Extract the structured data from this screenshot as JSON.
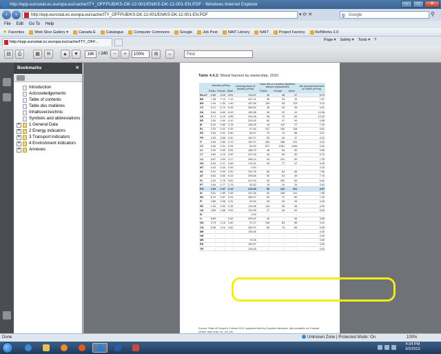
{
  "window": {
    "title": "http://epp.eurostat.ec.europa.eu/cache/ITY_OFFPUB/KS-DK-12-001/EN/KS-DK-12-001-EN.PDF - Windows Internet Explorer",
    "min": "–",
    "max": "□",
    "close": "✕"
  },
  "address": {
    "url": "http://epp.eurostat.ec.europa.eu/cache/ITY_OFFPUB/KS-DK-12-001/EN/KS-DK-12-001-EN.PDF",
    "tools": "▾ ⟳ ✕",
    "search_placeholder": "Google",
    "search_btn": "⚲"
  },
  "menu": [
    "File",
    "Edit",
    "Go To",
    "Help"
  ],
  "favorites": {
    "label": "Favorites",
    "items": [
      "Web Slice Gallery ▾",
      "Canada E",
      "Catalogue",
      "Computer Commons",
      "Google",
      "Job Post",
      "NAIT Library",
      "NAIT",
      "Project Factory",
      "RefWorks 2.0"
    ]
  },
  "tab": {
    "label": "http://epp.eurostat.ec.europa.eu/cache/ITY_OFF..."
  },
  "commands": [
    "Page ▾",
    "Safety ▾",
    "Tools ▾",
    "?"
  ],
  "pdf_toolbar": {
    "page": "186",
    "total": "/ 240",
    "zoom": "100%",
    "find_placeholder": "Find"
  },
  "bookmarks": {
    "title": "Bookmarks",
    "close": "✕",
    "items": [
      {
        "label": "Introduction",
        "expandable": false
      },
      {
        "label": "Acknowledgements",
        "expandable": false
      },
      {
        "label": "Table of contents",
        "expandable": false
      },
      {
        "label": "Table des matières",
        "expandable": false
      },
      {
        "label": "Inhaltsverzeichnis",
        "expandable": false
      },
      {
        "label": "Symbols and abbreviations",
        "expandable": false
      },
      {
        "label": "1 General Data",
        "expandable": true
      },
      {
        "label": "2 Energy indicators",
        "expandable": true
      },
      {
        "label": "3 Transport indicators",
        "expandable": true
      },
      {
        "label": "4 Environment indicators",
        "expandable": true
      },
      {
        "label": "Annexes",
        "expandable": true
      }
    ]
  },
  "document": {
    "table_title_bold": "Table 4.4.2:",
    "table_title_rest": " Wood harvest by ownership, 2010",
    "headers": {
      "group1": "Harvest (m³/ha)",
      "group2": "Growing stock of forests (m³/ha)",
      "group3": "Years left of constant depletion without replacement",
      "group4": "Net annual increment of FAWS (m³/ha)",
      "public": "Public",
      "private": "Private",
      "other": "Other"
    },
    "rows": [
      {
        "c": "EU-27",
        "v": [
          "3.65",
          "3.29",
          "3.61",
          "113.57",
          "40",
          "46",
          "37",
          "5.79"
        ],
        "cls": "eu"
      },
      {
        "c": "BE",
        "v": [
          "7.08",
          "7.13",
          "7.12",
          "247.21",
          "35",
          "33",
          "33",
          "7.87"
        ]
      },
      {
        "c": "BG",
        "v": [
          "1.44",
          "1.30",
          "1.40",
          "167.05",
          "116",
          "93",
          "113",
          "3.12"
        ]
      },
      {
        "c": "CZ",
        "v": [
          "8.11",
          "6.74",
          "6.45",
          "289.54",
          "46",
          "43",
          "45",
          "9.01"
        ]
      },
      {
        "c": "DK",
        "v": "5.40|6.60|6.00|150.38|28|22|41|10.06"
      },
      {
        "c": "DE",
        "v": "5.71|4.15|4.85|315.28|55|76|64|10.32"
      },
      {
        "c": "EE",
        "v": "3.30|4.40|4.10|200.05|60|47|49|5.56"
      },
      {
        "c": "IE",
        "v": "6.20|0.80|3.78|105.25|18|119|27|7.29"
      },
      {
        "c": "EL",
        "v": "0.32|0.32|0.32|47.40|147|150|148|4.61"
      },
      {
        "c": "ES",
        "v": "0.54|0.91|0.80|59.07|79|73|58|3.07"
      },
      {
        "c": "FR",
        "v": "2.05|3.66|3.40|161.07|55|44|47|6.23"
      },
      {
        "c": "IT",
        "v": "0.60|0.80|0.70|151.07|250|188|191|4.02"
      },
      {
        "c": "CY",
        "v": "0.06|0.04|0.05|50.00|872|1361|1096|0.52"
      },
      {
        "c": "LV",
        "v": "0.00|3.53|3.81|188.73|46|54|50|3.66"
      },
      {
        "c": "LT",
        "v": "3.64|4.10|3.30|207.43|44|56|50|5.74"
      },
      {
        "c": "LU",
        "v": "6.67|3.00|4.17|289.14|44|101|69|7.39"
      },
      {
        "c": "HU",
        "v": "5.34|2.27|3.83|174.41|34|77|47|5.45"
      },
      {
        "c": "MT",
        "v": "0.00|0.00|0.00|0.00|:|:|:|3.33"
      },
      {
        "c": "NL",
        "v": "2.02|3.00|2.90|191.78|66|64|66|7.83"
      },
      {
        "c": "AT",
        "v": "5.54|5.55|6.02|295.55|50|53|49|7.75"
      },
      {
        "c": "PL",
        "v": "4.42|0.75|3.81|247.54|55|330|65|6.62"
      },
      {
        "c": "PT",
        "v": "2.84|2.77|2.79|52.82|19|19|19|2.51"
      },
      {
        "c": "RO",
        "v": "2.00|2.37|2.12|213.00|90|122|101|4.67",
        "cls": "hl"
      },
      {
        "c": "SI",
        "v": "3.61|1.89|2.45|321.26|92|168|141|7.80"
      },
      {
        "c": "SK",
        "v": "6.70|3.67|5.31|265.27|40|72|50|7.42"
      },
      {
        "c": "FI",
        "v": "4.80|2.98|3.31|99.94|33|34|34|4.49"
      },
      {
        "c": "SE",
        "v": "1.00|2.90|2.45|113.26|113|38|46|4.09"
      },
      {
        "c": "UK",
        "v": "4.80|2.66|3.52|131.55|27|49|39|8.59"
      },
      {
        "c": "IS",
        "v": ":|:|:|0.00|:|:|:|:"
      },
      {
        "c": "LI",
        "v": "8.89|:|5.62|253.62|40|:|45|3.68"
      },
      {
        "c": "NO",
        "v": "0.75|1.16|1.82|97.27|135|83|85|3.41"
      },
      {
        "c": "CH",
        "v": "5.35|4.10|4.82|345.97|80|70|85|5.59"
      },
      {
        "c": "ME",
        "v": ":|:|:|155.46|:|:|:|4.00"
      },
      {
        "c": "HR",
        "v": ":|:|:|:|:|:|:|4.90"
      },
      {
        "c": "MK",
        "v": ":|:|:|76.26|:|:|:|4.50"
      },
      {
        "c": "RS",
        "v": ":|:|:|153.97|:|:|:|4.00"
      },
      {
        "c": "TR",
        "v": ":|:|:|134.63|:|:|:|4.04"
      }
    ],
    "footnote": "Source: State of Europe's Forests 2011, supplemented by Eurostat estimates, also available on Eurostat (online data code: for_vol_efi)"
  },
  "status": {
    "left": "Done",
    "zone": "Unknown Zone | Protected Mode: On",
    "zoom": "100%"
  },
  "taskbar": {
    "time": "4:34 PM",
    "date": "3/2/2013"
  },
  "colors": {
    "highlight": "#f2ee10",
    "table_header": "#cfe7f3"
  }
}
